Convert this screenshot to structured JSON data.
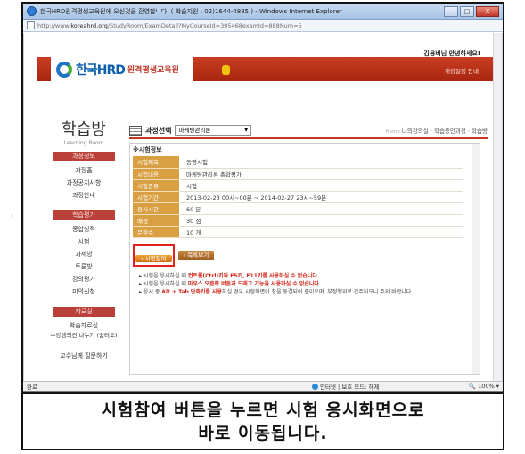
{
  "window": {
    "title": "한국HRD원격평생교육원에 오신것을 환영합니다. ( 학습지원 : 02)1644-4885 ) - Windows Internet Explorer",
    "url_prefix": "http://www.",
    "url_domain": "koreahrd.org",
    "url_path": "/StudyRoom/ExamDetail?MyCourseId=395468examId=888Num=5",
    "minimize": "–",
    "maximize": "□",
    "close": "X"
  },
  "header": {
    "greeting": "김용비님 안녕하세요!",
    "schedule_link": "개강일정 안내",
    "logo_text": "한국HRD",
    "logo_sub": "원격평생교육원"
  },
  "sidebar": {
    "page_title": "학습방",
    "page_subtitle": "Learning Room",
    "sections": [
      {
        "title": "과정정보",
        "items": [
          "과정홈",
          "과정공지사항",
          "과정안내"
        ]
      },
      {
        "title": "학습평가",
        "items": [
          "종합성적",
          "시험",
          "과제방",
          "토론방",
          "강의평가",
          "미의신청"
        ]
      },
      {
        "title": "자료실",
        "items": [
          "학습자료실",
          "수강생의견 나누기 (쉼터도)",
          "교수님께 질문하기"
        ]
      }
    ]
  },
  "main": {
    "course_label": "과정선택",
    "course_selected": "마케팅관리론",
    "breadcrumb_home": "Home",
    "breadcrumb": "나의강의실 · 학습중인과정 · 학습방",
    "info_title": "※시험정보",
    "info_rows": [
      {
        "key": "시험제목",
        "value": "동영시험"
      },
      {
        "key": "시험내용",
        "value": "마케팅관리론 총합평가"
      },
      {
        "key": "시험종류",
        "value": "시험"
      },
      {
        "key": "시험기간",
        "value": "2013-02-23 00시~00분 ~ 2014-02-27 23시~59분"
      },
      {
        "key": "응시시간",
        "value": "60 분"
      },
      {
        "key": "배점",
        "value": "30 점"
      },
      {
        "key": "문항수",
        "value": "10 개"
      }
    ],
    "take_exam_button": "시험참여",
    "list_button": "목록보기",
    "notes": [
      {
        "pre": "▸ 시험을 응시하실 때 ",
        "red": "컨트롤(Ctrl)키와 F5키, F11키를 사용하실 수 없습니다.",
        "post": ""
      },
      {
        "pre": "▸ 시험을 응시하실 때 ",
        "red": "마우스 오른쪽 버튼과 드래그 기능을 사용하실 수 없습니다.",
        "post": ""
      },
      {
        "pre": "▸ 응시 중 ",
        "red": "Alt + Tab 단축키를 사용",
        "post": "하실 경우 시험화면이 창을 동결되어 줄이오며, 부정행위로 간주되오니 주의 바랍니다."
      }
    ]
  },
  "statusbar": {
    "done": "완료",
    "zone": "인터넷 | 보호 모드: 해제",
    "zoom": "100%"
  },
  "caption": {
    "line1": "시험참여 버튼을 누르면 시험 응시화면으로",
    "line2": "바로 이동됩니다."
  }
}
